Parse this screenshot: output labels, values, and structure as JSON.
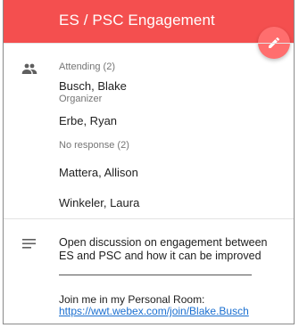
{
  "header": {
    "title": "ES / PSC Engagement",
    "color": "#f44f4f",
    "edit_icon": "pencil-icon"
  },
  "attendees": {
    "icon": "people-icon",
    "attending_label": "Attending (2)",
    "attending": [
      {
        "name": "Busch, Blake",
        "role": "Organizer"
      },
      {
        "name": "Erbe, Ryan"
      }
    ],
    "no_response_label": "No response (2)",
    "no_response": [
      {
        "name": "Mattera, Allison"
      },
      {
        "name": "Winkeler, Laura"
      }
    ]
  },
  "notes": {
    "icon": "notes-icon",
    "description": "Open discussion on engagement between ES and PSC and how it can be improved",
    "join_text": "Join me in my Personal Room:",
    "join_link": "https://wwt.webex.com/join/Blake.Busch",
    "link_color": "#1a6fd0"
  }
}
